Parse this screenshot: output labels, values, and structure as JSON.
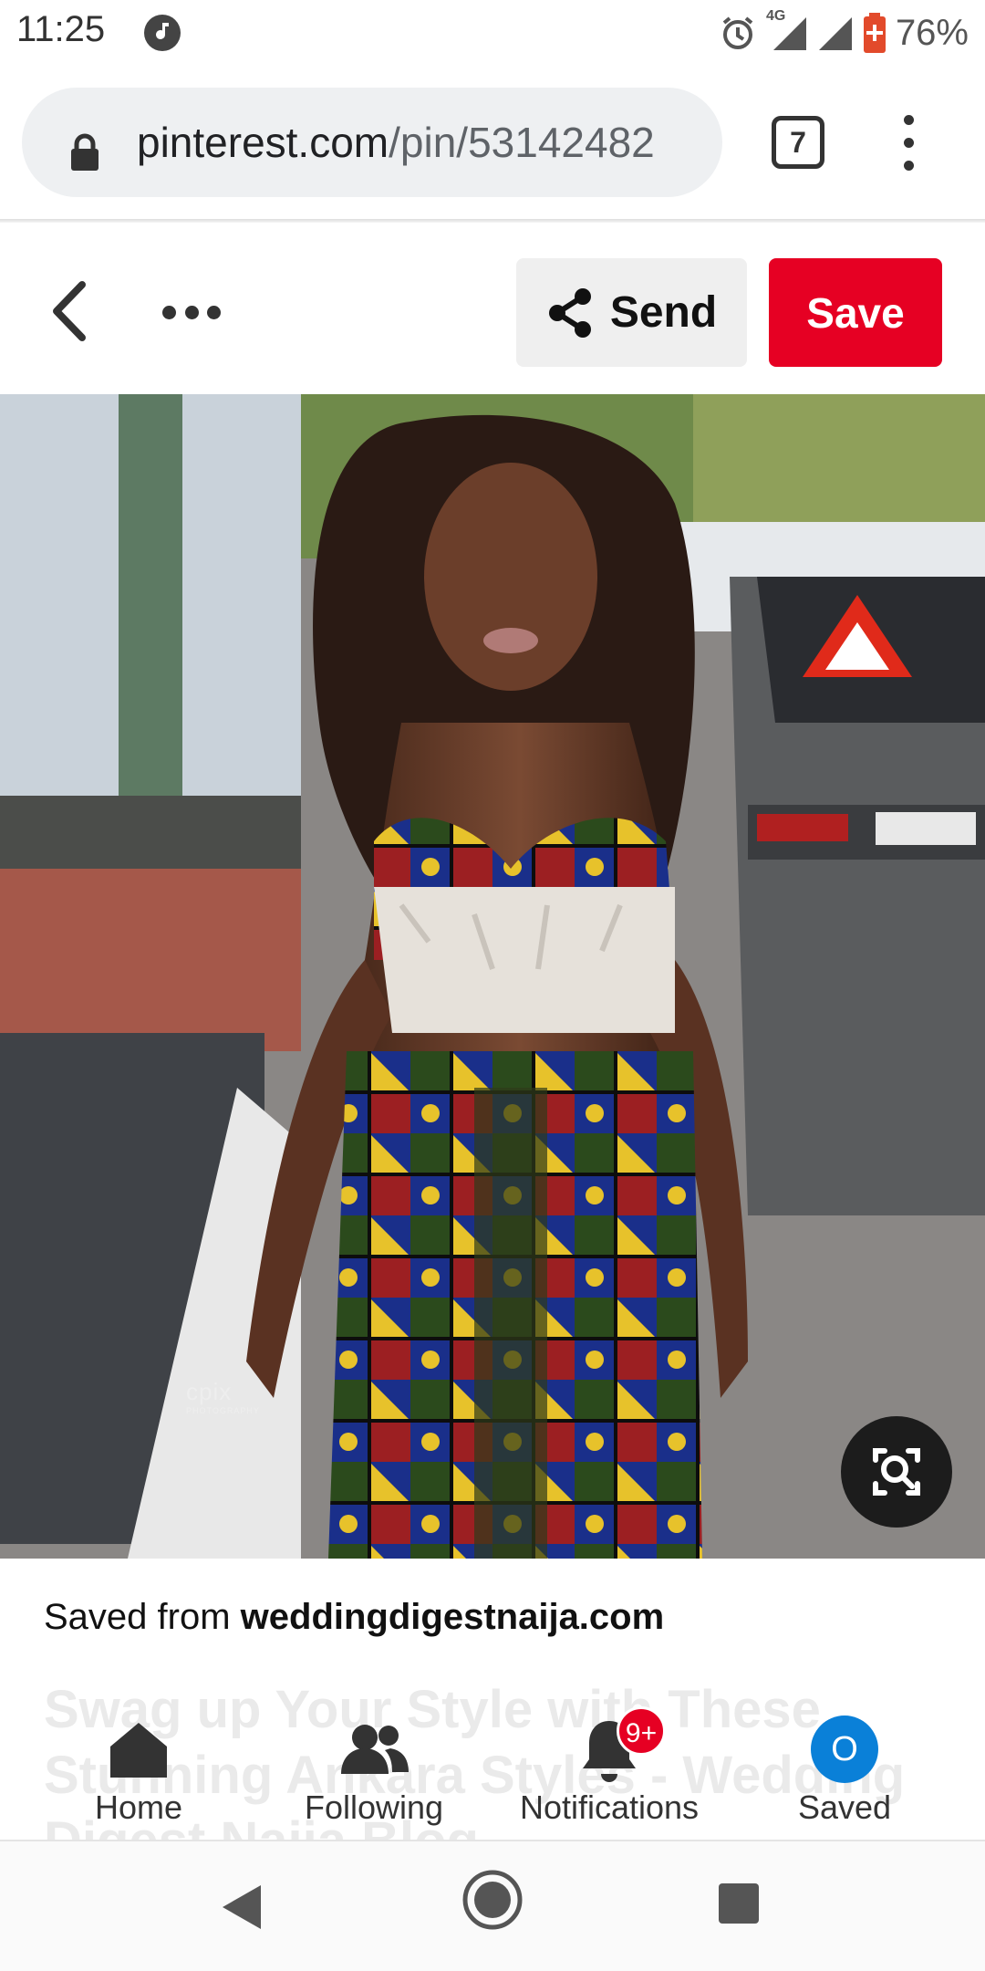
{
  "status_bar": {
    "time": "11:25",
    "network": "4G",
    "battery": "76%"
  },
  "browser": {
    "url_domain": "pinterest.com",
    "url_path": "/pin/53142482",
    "tab_count": "7"
  },
  "pin_header": {
    "send_label": "Send",
    "save_label": "Save"
  },
  "pin": {
    "watermark": "cpix",
    "watermark_sub": "PHOTOGRAPHY",
    "saved_from_prefix": "Saved from",
    "saved_from_source": "weddingdigestnaija.com",
    "title": "Swag up Your Style with These Stunning Ankara Styles - Wedding Digest Naija Blog"
  },
  "bottom_nav": {
    "items": [
      {
        "label": "Home"
      },
      {
        "label": "Following"
      },
      {
        "label": "Notifications"
      },
      {
        "label": "Saved"
      }
    ],
    "notifications_badge": "9+",
    "saved_avatar_letter": "O"
  },
  "colors": {
    "save_red": "#e60023",
    "avatar_blue": "#0a80d8"
  }
}
